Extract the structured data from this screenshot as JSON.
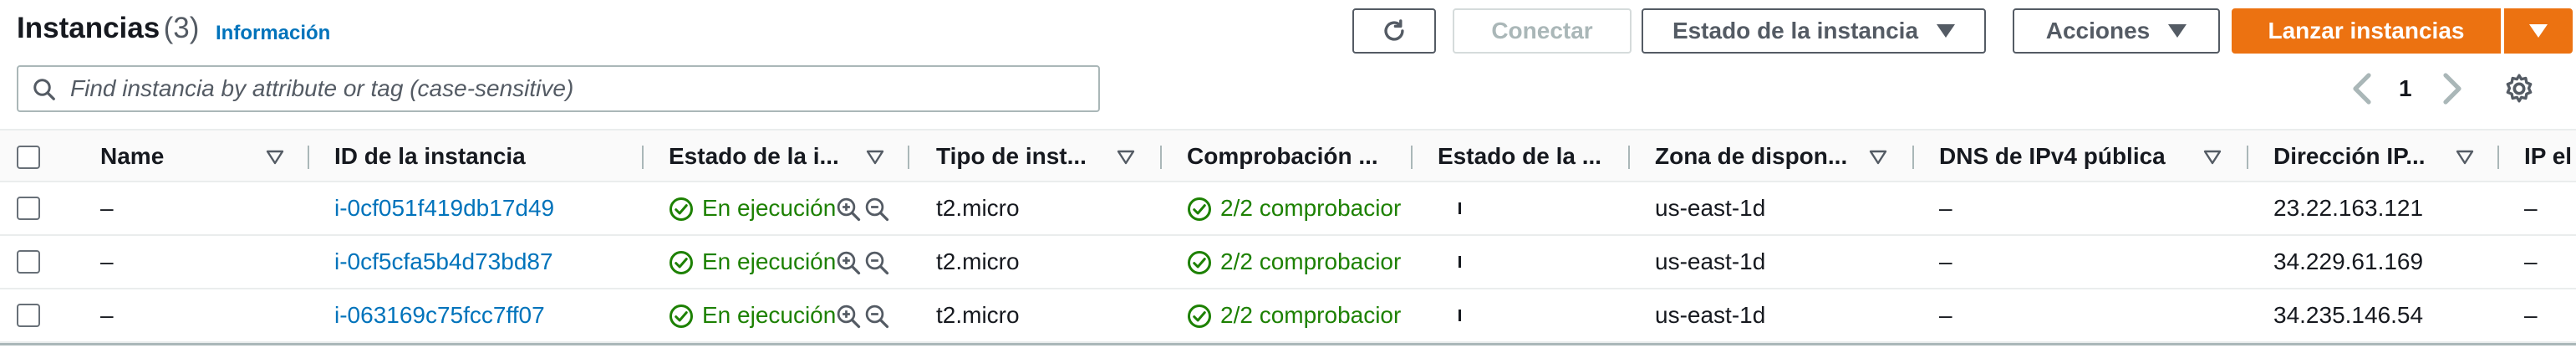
{
  "header": {
    "title": "Instancias",
    "count": "(3)",
    "info_link": "Información"
  },
  "toolbar": {
    "refresh_icon": "refresh-icon",
    "connect_label": "Conectar",
    "instance_state_label": "Estado de la instancia",
    "actions_label": "Acciones",
    "launch_label": "Lanzar instancias"
  },
  "search": {
    "placeholder": "Find instancia by attribute or tag (case-sensitive)",
    "value": ""
  },
  "pagination": {
    "current_page": "1"
  },
  "table": {
    "columns": [
      "Name",
      "ID de la instancia",
      "Estado de la i...",
      "Tipo de inst...",
      "Comprobación ...",
      "Estado de la ...",
      "Zona de dispon...",
      "DNS de IPv4 pública",
      "Dirección IP...",
      "IP el"
    ],
    "rows": [
      {
        "name": "–",
        "instance_id": "i-0cf051f419db17d49",
        "state": "En ejecución",
        "type": "t2.micro",
        "check": "2/2 comprobacior",
        "zone": "us-east-1d",
        "dns": "–",
        "ip": "23.22.163.121",
        "elastic_ip": "–"
      },
      {
        "name": "–",
        "instance_id": "i-0cf5cfa5b4d73bd87",
        "state": "En ejecución",
        "type": "t2.micro",
        "check": "2/2 comprobacior",
        "zone": "us-east-1d",
        "dns": "–",
        "ip": "34.229.61.169",
        "elastic_ip": "–"
      },
      {
        "name": "–",
        "instance_id": "i-063169c75fcc7ff07",
        "state": "En ejecución",
        "type": "t2.micro",
        "check": "2/2 comprobacior",
        "zone": "us-east-1d",
        "dns": "–",
        "ip": "34.235.146.54",
        "elastic_ip": "–"
      }
    ]
  },
  "colors": {
    "primary": "#ec7211",
    "link": "#0073bb",
    "success": "#1d8102",
    "text": "#16191f",
    "border": "#aab7b8"
  }
}
